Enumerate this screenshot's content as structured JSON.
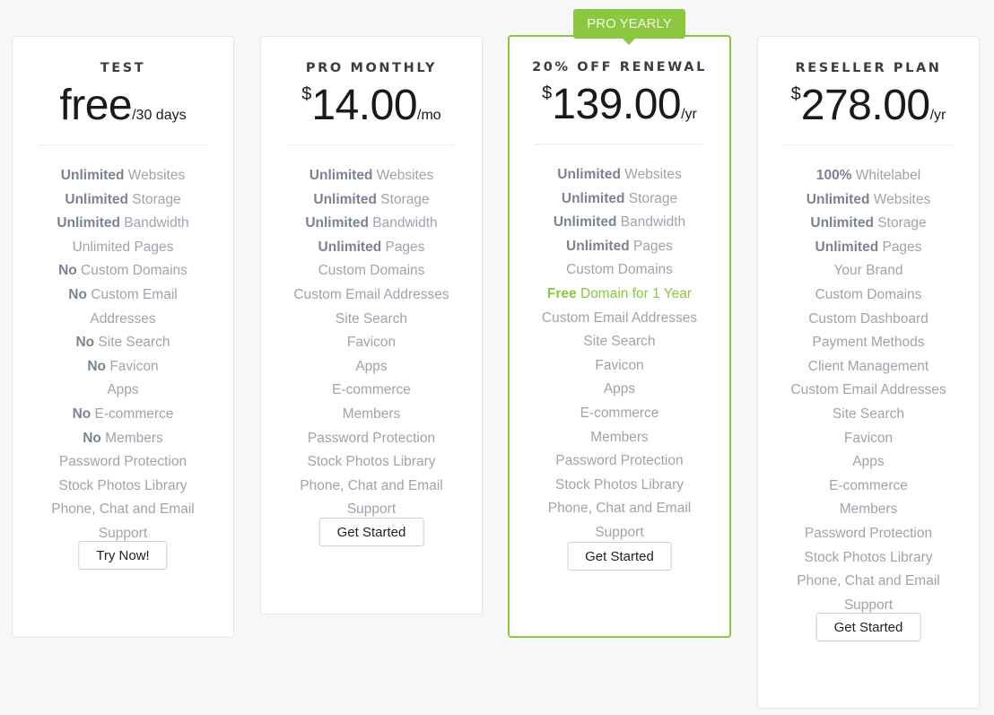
{
  "plans": [
    {
      "title": "TEST",
      "currency": "",
      "amount": "free",
      "period": "/30 days",
      "features": [
        {
          "bold": "Unlimited",
          "text": " Websites"
        },
        {
          "bold": "Unlimited",
          "text": " Storage"
        },
        {
          "bold": "Unlimited",
          "text": " Bandwidth"
        },
        {
          "bold": "",
          "text": "Unlimited Pages"
        },
        {
          "bold": "No",
          "text": " Custom Domains"
        },
        {
          "bold": "No",
          "text": " Custom Email"
        },
        {
          "bold": "",
          "text": "Addresses"
        },
        {
          "bold": "No",
          "text": " Site Search"
        },
        {
          "bold": "No",
          "text": " Favicon"
        },
        {
          "bold": "",
          "text": "Apps"
        },
        {
          "bold": "No",
          "text": " E-commerce"
        },
        {
          "bold": "No",
          "text": " Members"
        },
        {
          "bold": "",
          "text": "Password Protection"
        },
        {
          "bold": "",
          "text": "Stock Photos Library"
        },
        {
          "bold": "",
          "text": "Phone, Chat and Email"
        },
        {
          "bold": "",
          "text": "Support"
        }
      ],
      "button": "Try Now!"
    },
    {
      "title": "PRO MONTHLY",
      "currency": "$",
      "amount": "14.00",
      "period": "/mo",
      "features": [
        {
          "bold": "Unlimited",
          "text": " Websites"
        },
        {
          "bold": "Unlimited",
          "text": " Storage"
        },
        {
          "bold": "Unlimited",
          "text": " Bandwidth"
        },
        {
          "bold": "Unlimited",
          "text": " Pages"
        },
        {
          "bold": "",
          "text": "Custom Domains"
        },
        {
          "bold": "",
          "text": "Custom Email Addresses"
        },
        {
          "bold": "",
          "text": "Site Search"
        },
        {
          "bold": "",
          "text": "Favicon"
        },
        {
          "bold": "",
          "text": "Apps"
        },
        {
          "bold": "",
          "text": "E-commerce"
        },
        {
          "bold": "",
          "text": "Members"
        },
        {
          "bold": "",
          "text": "Password Protection"
        },
        {
          "bold": "",
          "text": "Stock Photos Library"
        },
        {
          "bold": "",
          "text": "Phone, Chat and Email"
        },
        {
          "bold": "",
          "text": "Support"
        }
      ],
      "button": "Get Started"
    },
    {
      "ribbon": "PRO YEARLY",
      "title": "20% OFF RENEWAL",
      "currency": "$",
      "amount": "139.00",
      "period": "/yr",
      "features": [
        {
          "bold": "Unlimited",
          "text": " Websites"
        },
        {
          "bold": "Unlimited",
          "text": " Storage"
        },
        {
          "bold": "Unlimited",
          "text": " Bandwidth"
        },
        {
          "bold": "Unlimited",
          "text": " Pages"
        },
        {
          "bold": "",
          "text": "Custom Domains"
        },
        {
          "bold": "Free",
          "text": " Domain for 1 Year",
          "highlight": true
        },
        {
          "bold": "",
          "text": "Custom Email Addresses"
        },
        {
          "bold": "",
          "text": "Site Search"
        },
        {
          "bold": "",
          "text": "Favicon"
        },
        {
          "bold": "",
          "text": "Apps"
        },
        {
          "bold": "",
          "text": "E-commerce"
        },
        {
          "bold": "",
          "text": "Members"
        },
        {
          "bold": "",
          "text": "Password Protection"
        },
        {
          "bold": "",
          "text": "Stock Photos Library"
        },
        {
          "bold": "",
          "text": "Phone, Chat and Email"
        },
        {
          "bold": "",
          "text": "Support"
        }
      ],
      "button": "Get Started"
    },
    {
      "title": "RESELLER PLAN",
      "currency": "$",
      "amount": "278.00",
      "period": "/yr",
      "features": [
        {
          "bold": "100%",
          "text": " Whitelabel"
        },
        {
          "bold": "Unlimited",
          "text": " Websites"
        },
        {
          "bold": "Unlimited",
          "text": " Storage"
        },
        {
          "bold": "Unlimited",
          "text": " Pages"
        },
        {
          "bold": "",
          "text": "Your Brand"
        },
        {
          "bold": "",
          "text": "Custom Domains"
        },
        {
          "bold": "",
          "text": "Custom Dashboard"
        },
        {
          "bold": "",
          "text": "Payment Methods"
        },
        {
          "bold": "",
          "text": "Client Management"
        },
        {
          "bold": "",
          "text": "Custom Email Addresses"
        },
        {
          "bold": "",
          "text": "Site Search"
        },
        {
          "bold": "",
          "text": "Favicon"
        },
        {
          "bold": "",
          "text": "Apps"
        },
        {
          "bold": "",
          "text": "E-commerce"
        },
        {
          "bold": "",
          "text": "Members"
        },
        {
          "bold": "",
          "text": "Password Protection"
        },
        {
          "bold": "",
          "text": "Stock Photos Library"
        },
        {
          "bold": "",
          "text": "Phone, Chat and Email"
        },
        {
          "bold": "",
          "text": "Support"
        }
      ],
      "button": "Get Started"
    }
  ],
  "colors": {
    "accent": "#8dc63f",
    "feature_text": "#9ea4ad",
    "feature_bold": "#7c8390",
    "title": "#3a3d42"
  }
}
